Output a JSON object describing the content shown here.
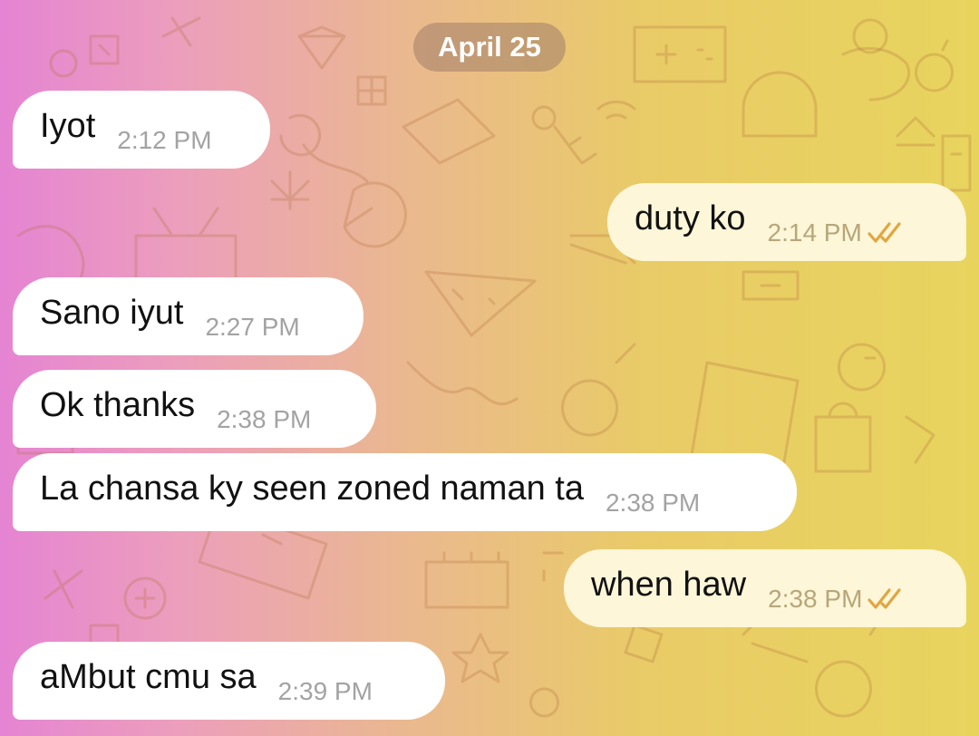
{
  "chat": {
    "date_separator": "April 25",
    "accent_color": "#e0a642",
    "messages": [
      {
        "direction": "incoming",
        "text": "Iyot",
        "time": "2:12 PM"
      },
      {
        "direction": "outgoing",
        "text": "duty ko",
        "time": "2:14 PM",
        "status": "read"
      },
      {
        "direction": "incoming",
        "text": "Sano iyut",
        "time": "2:27 PM"
      },
      {
        "direction": "incoming",
        "text": "Ok thanks",
        "time": "2:38 PM"
      },
      {
        "direction": "incoming",
        "text": "La chansa ky seen zoned naman ta",
        "time": "2:38 PM"
      },
      {
        "direction": "outgoing",
        "text": "when haw",
        "time": "2:38 PM",
        "status": "read"
      },
      {
        "direction": "incoming",
        "text": "aMbut cmu sa",
        "time": "2:39 PM"
      }
    ]
  }
}
